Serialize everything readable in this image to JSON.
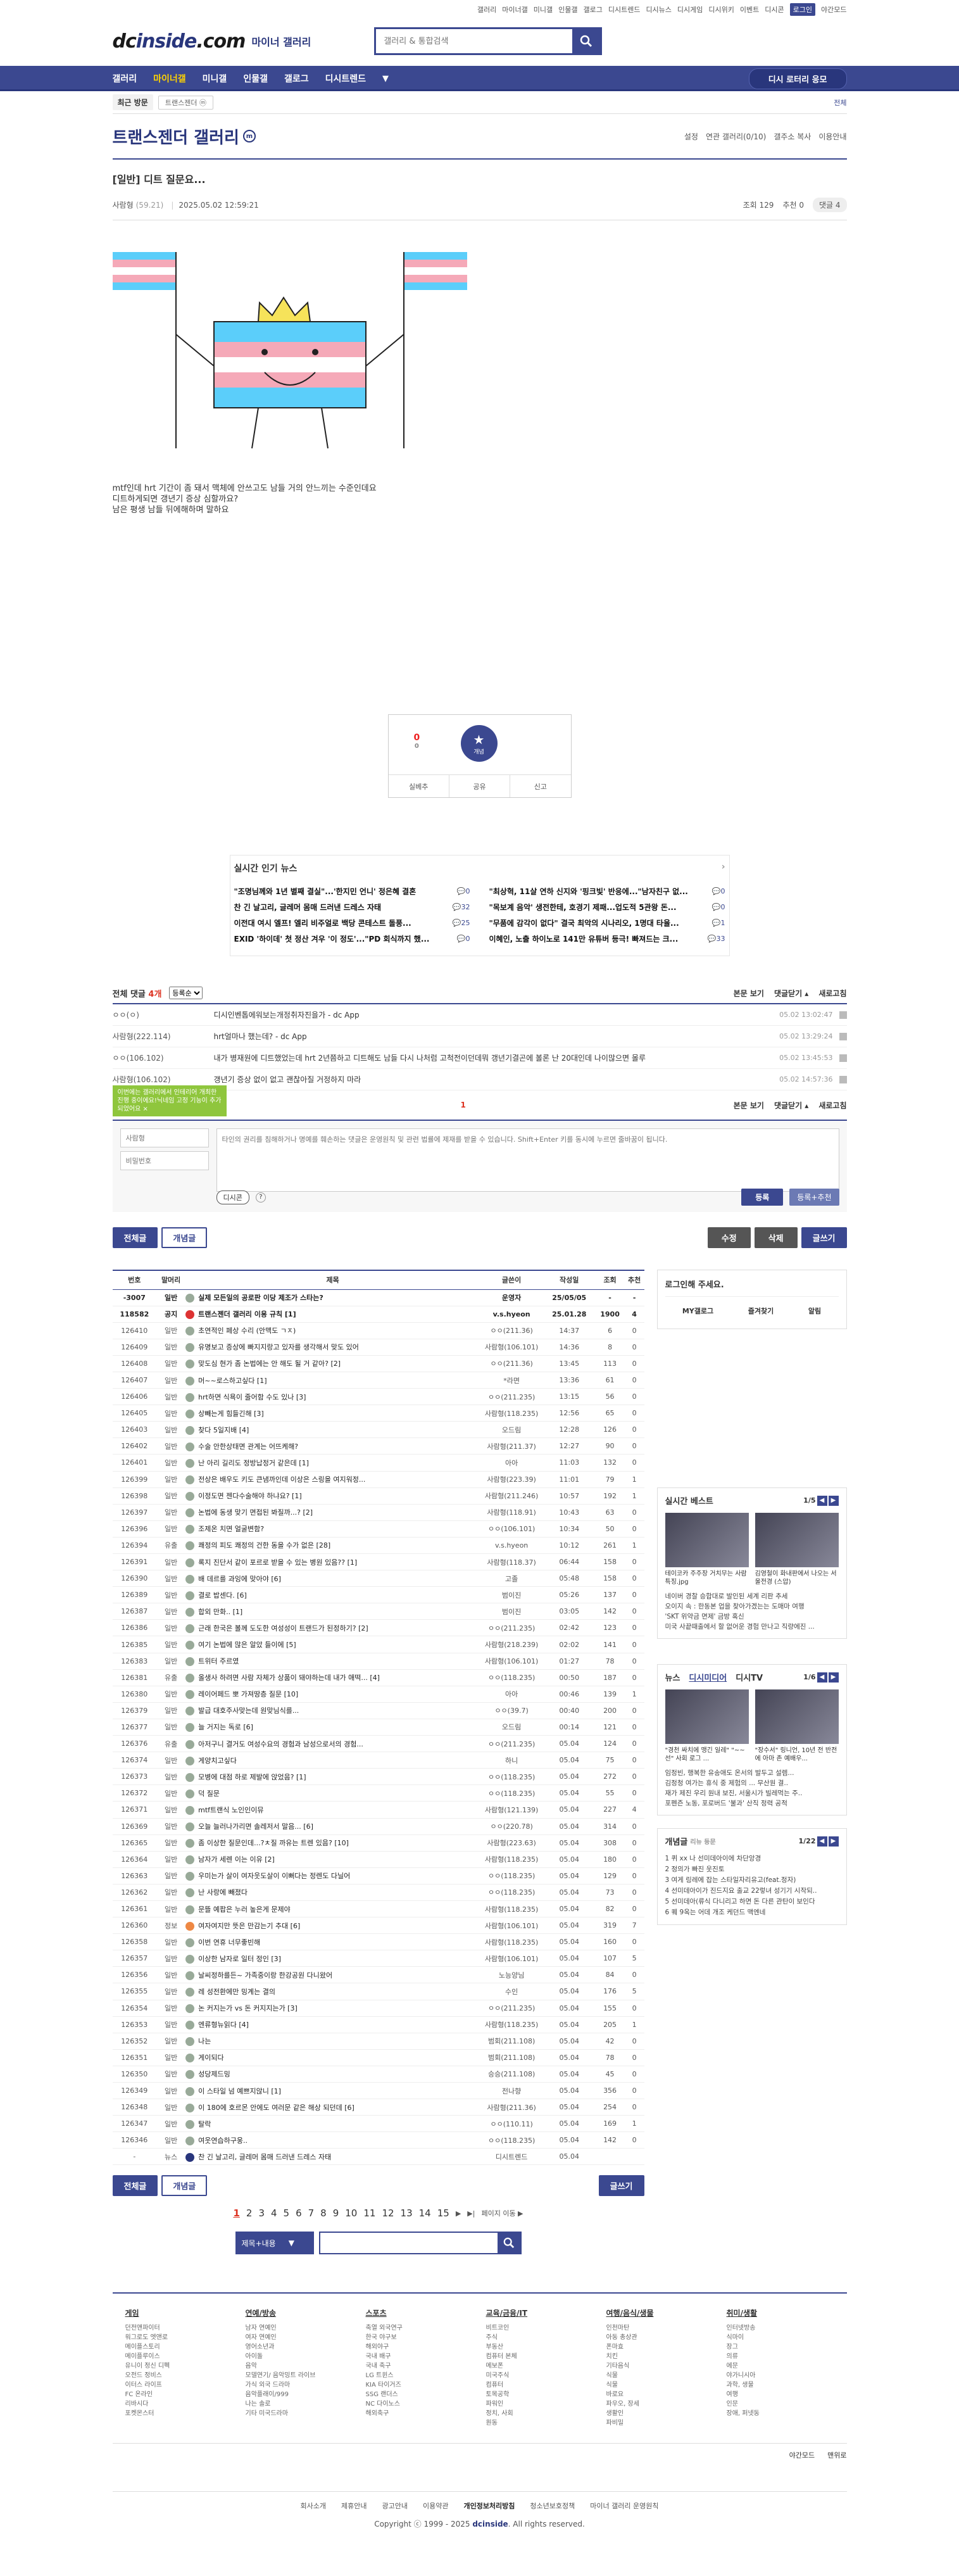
{
  "util": [
    "갤러리",
    "마이너갤",
    "미니갤",
    "인물갤",
    "갤로그",
    "디시트렌드",
    "디시뉴스",
    "디시게임",
    "디시위키",
    "이벤트",
    "디시콘",
    "로그인",
    "야간모드"
  ],
  "header": {
    "logo_a": "dc",
    "logo_b": "inside",
    "logo_c": ".com",
    "sub": "마이너 갤러리",
    "search_placeholder": "갤러리 & 통합검색"
  },
  "gnb": {
    "items": [
      "갤러리",
      "마이너갤",
      "미니갤",
      "인물갤",
      "갤로그",
      "디시트렌드"
    ],
    "active": "마이너갤",
    "apply": "디시 로터리 응모"
  },
  "visit": {
    "label": "최근 방문",
    "chip": "트랜스젠더 ⓜ",
    "all": "전체"
  },
  "gallery": {
    "title": "트랜스젠더 갤러리",
    "badge": "m",
    "right": [
      "설정",
      "연관 갤러리(0/10)",
      "갤주소 복사",
      "이용안내"
    ]
  },
  "post": {
    "head": "[일반]",
    "title": "디트 질문요...",
    "writer": "사람형",
    "ip": "(59.21)",
    "date": "2025.05.02 12:59:21",
    "views": "조회 129",
    "rec": "추천 0",
    "cmt_btn": "댓글 4",
    "lines": [
      "mtf인데 hrt 기간이 좀 돼서 맥체에 안쓰고도 남들 거의 안느끼는 수준인데요",
      "디트하게되면 갱년기 증상 심할까요?",
      "남은 평생 남들 뒤에해하며 말하요"
    ]
  },
  "vote": {
    "up": "0",
    "up_sub": "0",
    "best": "개념",
    "actions": [
      "실베추",
      "공유",
      "신고"
    ]
  },
  "news": {
    "title": "실시간 인기 뉴스",
    "items": [
      {
        "t": "\"조명님께와 1년 별째 결실\"...'한지민 언니' 정은혜 결혼",
        "c": "0"
      },
      {
        "t": "\"최상혁, 11살 연하 신지와 '핑크빛' 반응에...\"남자친구 없...",
        "c": "0"
      },
      {
        "t": "찬 긴 날고리, 글레머 몸매 드러낸 드레스 자태",
        "c": "32"
      },
      {
        "t": "\"목보계 음악' 생전한테, 호경기 제패...업도적 5관왕 돈...",
        "c": "0"
      },
      {
        "t": "이전대 여시 엘프! 엘리 비주얼로 백당 콘테스트 돌풍...",
        "c": "25"
      },
      {
        "t": "\"무품에 감각이 없다\" 결국 최악의 시나리오, 1명대 타율...",
        "c": "1"
      },
      {
        "t": "EXID '하이데' 첫 정산 겨우 '이 정도'...\"PD 회식까지 했...",
        "c": "0"
      },
      {
        "t": "이혜인, 노출 하이노로 141만 유튜버 등극! 빠져드는 크...",
        "c": "33"
      }
    ]
  },
  "comments": {
    "label": "전체 댓글",
    "count": "4개",
    "sort": "등록순",
    "actions": [
      "본문 보기",
      "댓글닫기 ▴",
      "새로고침"
    ],
    "rows": [
      {
        "w": "ㅇㅇ(ㅇ)",
        "c": "디시인벤톱에워보는개정취자진을가 - dc App",
        "d": "05.02 13:02:47"
      },
      {
        "w": "사람형(222.114)",
        "c": "hrt얼마나 했는데? - dc App",
        "d": "05.02 13:29:24"
      },
      {
        "w": "ㅇㅇ(106.102)",
        "c": "내가 병재원에 디트했었는데 hrt 2년쯤하고 디트해도 남들 다시 나처럼 고척전이던데뭐 갱년기결곤에 볼론 난 20대인데 나이많으면 몰루",
        "d": "05.02 13:45:53"
      },
      {
        "w": "사람형(106.102)",
        "c": "갱년기 증상 없이 없고 괜찮아질 거정하지 마라",
        "d": "05.02 14:57:36"
      }
    ],
    "page": "1",
    "tip": "이번에는 갤러리에서 인테리어 개최한 진행 중이에요!닉네임 고정 기능이 추가되었어요 ×",
    "id_ph": "사람형",
    "pw_ph": "비밀번호",
    "write_ph": "타인의 권리를 침해하거나 명예를 훼손하는 댓글은 운영원칙 및 관련 법률에 제재를 받을 수 있습니다. Shift+Enter 키를 동시에 누르면 줄바꿈이 됩니다.",
    "dccon": "디시콘",
    "reg": "등록",
    "reg2": "등록+추천"
  },
  "btns": {
    "all": "전체글",
    "best": "개념글",
    "edit": "수정",
    "del": "삭제",
    "write": "글쓰기"
  },
  "table": {
    "cols": [
      "번호",
      "말머리",
      "제목",
      "글쓴이",
      "작성일",
      "조회",
      "추천"
    ],
    "rows": [
      [
        "-3007",
        "일반",
        "실제 모든일의 공로판 이당 제조가 스타는?",
        "",
        "운영자",
        "25/05/05",
        "-",
        "-",
        "n"
      ],
      [
        "118582",
        "공지",
        "트랜스젠더 갤러리 이용 규칙 [1]",
        "",
        "v.s.hyeon",
        "25.01.28",
        "1900",
        "4",
        "n"
      ],
      [
        "126410",
        "일반",
        "초연적인 페상 수리 (안맥도 ㄱㅈ)",
        "",
        "ㅇㅇ(211.36)",
        "14:37",
        "6",
        "0",
        ""
      ],
      [
        "126409",
        "일반",
        "유명보고 증상에 빠지지랑고 있자를 생각해서 맞도 있어",
        "",
        "사람형(106.101)",
        "14:36",
        "8",
        "0",
        ""
      ],
      [
        "126408",
        "일반",
        "맞도심 현가 좀 논법에는 안 해도 될 거 같아? [2]",
        "",
        "ㅇㅇ(211.36)",
        "13:45",
        "113",
        "0",
        ""
      ],
      [
        "126407",
        "일반",
        "머~~로스하고싶다 [1]",
        "",
        "*라면",
        "13:36",
        "61",
        "0",
        ""
      ],
      [
        "126406",
        "일반",
        "hrt하면 식욕이 줄어함 수도 있나 [3]",
        "",
        "ㅇㅇ(211.235)",
        "13:15",
        "56",
        "0",
        ""
      ],
      [
        "126405",
        "일반",
        "상빼는게 힘들긴해 [3]",
        "",
        "사람형(118.235)",
        "12:56",
        "65",
        "0",
        ""
      ],
      [
        "126403",
        "일반",
        "찾다 5일지배 [4]",
        "",
        "오드림",
        "12:28",
        "126",
        "0",
        ""
      ],
      [
        "126402",
        "일반",
        "수술 안한상태면 관계는 어뜨케해?",
        "",
        "사람형(211.37)",
        "12:27",
        "90",
        "0",
        ""
      ],
      [
        "126401",
        "일반",
        "난 아리 길리도 정방납정거 같은데 [1]",
        "",
        "아아",
        "11:03",
        "132",
        "0",
        ""
      ],
      [
        "126399",
        "일반",
        "전상은 배우도 키도 큰냄까인데 이상은 스링을 여지워정...",
        "",
        "사람형(223.39)",
        "11:01",
        "79",
        "1",
        ""
      ],
      [
        "126398",
        "일반",
        "이정도면 젠다수술해야 하냐요? [1]",
        "",
        "사람형(211.246)",
        "10:57",
        "192",
        "1",
        ""
      ],
      [
        "126397",
        "일반",
        "논법에 동생 맞기 면접된 봐질까...? [2]",
        "",
        "사람형(118.91)",
        "10:43",
        "63",
        "0",
        ""
      ],
      [
        "126396",
        "일반",
        "조제온 치면 얼굴변함?",
        "",
        "ㅇㅇ(106.101)",
        "10:34",
        "50",
        "0",
        ""
      ],
      [
        "126394",
        "유출",
        "쾌정의 피도 쾌정의 건한 동을 수가 없은 [28]",
        "",
        "v.s.hyeon",
        "10:12",
        "261",
        "1",
        ""
      ],
      [
        "126391",
        "일반",
        "록지 진단서 같이 포르로 받을 수 있는 병원 있음?? [1]",
        "",
        "사람형(118.37)",
        "06:44",
        "158",
        "0",
        ""
      ],
      [
        "126390",
        "일반",
        "배 데르를 과잉에 맞아야 [6]",
        "",
        "고졸",
        "05:48",
        "158",
        "0",
        ""
      ],
      [
        "126389",
        "일반",
        "결로 밥센다. [6]",
        "",
        "범이진",
        "05:26",
        "137",
        "0",
        ""
      ],
      [
        "126387",
        "일반",
        "합외 만화.. [1]",
        "",
        "범이진",
        "03:05",
        "142",
        "0",
        ""
      ],
      [
        "126386",
        "일반",
        "근래 한국은 볼께 도도한 여성성이 트랜드가 된정하기? [2]",
        "",
        "ㅇㅇ(211.235)",
        "02:42",
        "123",
        "0",
        ""
      ],
      [
        "126385",
        "일반",
        "여기 논법에 많은 알았 들이에 [5]",
        "",
        "사람형(218.239)",
        "02:02",
        "141",
        "0",
        ""
      ],
      [
        "126383",
        "일반",
        "트위터 주르였",
        "",
        "사람형(106.101)",
        "01:27",
        "78",
        "0",
        ""
      ],
      [
        "126381",
        "유출",
        "올생사 하려면 사람 자체가 상품이 돼야하는데 내가 애떡... [4]",
        "",
        "ㅇㅇ(118.235)",
        "00:50",
        "187",
        "0",
        ""
      ],
      [
        "126380",
        "일반",
        "레이어페드 뽀 가져땅층 질문 [10]",
        "",
        "아아",
        "00:46",
        "139",
        "1",
        ""
      ],
      [
        "126379",
        "일반",
        "발급 대호주사맞는데 원맞님식를...",
        "",
        "ㅇㅇ(39.7)",
        "00:40",
        "200",
        "0",
        ""
      ],
      [
        "126377",
        "일반",
        "늘 거지는 독로 [6]",
        "",
        "오드림",
        "00:14",
        "121",
        "0",
        ""
      ],
      [
        "126376",
        "유출",
        "아저구니 결거도 여성수요의 경험과 남성으로서의 경험...",
        "",
        "ㅇㅇ(211.235)",
        "05.04",
        "124",
        "0",
        ""
      ],
      [
        "126374",
        "일반",
        "게양치고싶다",
        "",
        "하니",
        "05.04",
        "75",
        "0",
        ""
      ],
      [
        "126373",
        "일반",
        "모병에 대점 하로 제발에 앉었음? [1]",
        "",
        "ㅇㅇ(118.235)",
        "05.04",
        "272",
        "0",
        ""
      ],
      [
        "126372",
        "일반",
        "덕 질문",
        "",
        "ㅇㅇ(118.235)",
        "05.04",
        "55",
        "0",
        ""
      ],
      [
        "126371",
        "일반",
        "mtf트랜식 노인인이뮤",
        "",
        "사람형(121.139)",
        "05.04",
        "227",
        "4",
        ""
      ],
      [
        "126369",
        "일반",
        "오늘 늘러나가리면 솔레저서 말음... [6]",
        "",
        "ㅇㅇ(220.78)",
        "05.04",
        "314",
        "0",
        ""
      ],
      [
        "126365",
        "일반",
        "좀 이상한 질문인데...?ㅊ질 까유는 트렌 있음? [10]",
        "",
        "사람형(223.63)",
        "05.04",
        "308",
        "0",
        ""
      ],
      [
        "126364",
        "일반",
        "남자가 세렌 이는 이유 [2]",
        "",
        "사람형(118.235)",
        "05.04",
        "180",
        "0",
        ""
      ],
      [
        "126363",
        "일반",
        "우미는가 살이 여자웃도살이 이뻐다는 정렌도 다닐어",
        "",
        "ㅇㅇ(118.235)",
        "05.04",
        "129",
        "0",
        ""
      ],
      [
        "126362",
        "일반",
        "난 사랑에 빼졌다",
        "",
        "ㅇㅇ(118.235)",
        "05.04",
        "73",
        "0",
        ""
      ],
      [
        "126361",
        "일반",
        "문뜰 예팝은 누러 높은게 문제야",
        "",
        "사람형(118.235)",
        "05.04",
        "82",
        "0",
        ""
      ],
      [
        "126360",
        "정보",
        "여자여지만 뜻은 만감는기 추대 [6]",
        "",
        "사람형(106.101)",
        "05.04",
        "319",
        "7",
        ""
      ],
      [
        "126358",
        "일반",
        "이번 연휴 너무좋빈해",
        "",
        "사람형(118.235)",
        "05.04",
        "160",
        "0",
        ""
      ],
      [
        "126357",
        "일반",
        "이상한 남자로 일터 정인 [3]",
        "",
        "사람형(106.101)",
        "05.04",
        "107",
        "5",
        ""
      ],
      [
        "126356",
        "일반",
        "날씨정하를든~ 가족중이랑 한강공원 다니왔어",
        "",
        "노능양님",
        "05.04",
        "84",
        "0",
        ""
      ],
      [
        "126355",
        "일반",
        "레 성전환에만 밍계는 결의",
        "",
        "수인",
        "05.04",
        "176",
        "5",
        ""
      ],
      [
        "126354",
        "일반",
        "논 커지는가 vs 돈 커지지는가 [3]",
        "",
        "ㅇㅇ(211.235)",
        "05.04",
        "155",
        "0",
        ""
      ],
      [
        "126353",
        "일반",
        "엔류형뉴읽다 [4]",
        "",
        "사람형(118.235)",
        "05.04",
        "205",
        "1",
        ""
      ],
      [
        "126352",
        "일반",
        "나는",
        "",
        "범회(211.108)",
        "05.04",
        "42",
        "0",
        ""
      ],
      [
        "126351",
        "일반",
        "게이되다",
        "",
        "범회(211.108)",
        "05.04",
        "78",
        "0",
        ""
      ],
      [
        "126350",
        "일반",
        "성당제드밍",
        "",
        "승승(211.108)",
        "05.04",
        "45",
        "0",
        ""
      ],
      [
        "126349",
        "일반",
        "이 스타일 넘 예쁘지않니 [1]",
        "",
        "전나향",
        "05.04",
        "356",
        "0",
        ""
      ],
      [
        "126348",
        "일반",
        "이 180에 호르몬 안에도 여러문 같은 해상 되던데 [6]",
        "",
        "사람형(211.36)",
        "05.04",
        "254",
        "0",
        ""
      ],
      [
        "126347",
        "일반",
        "탈락",
        "",
        "ㅇㅇ(110.11)",
        "05.04",
        "169",
        "1",
        ""
      ],
      [
        "126346",
        "일반",
        "여웃연습하구웅..",
        "",
        "ㅇㅇ(118.235)",
        "05.04",
        "142",
        "0",
        ""
      ],
      [
        "-",
        "뉴스",
        "찬 긴 날고리, 글레머 몸매 드러낸 드레스 자태",
        "",
        "디시트렌드",
        "05.04",
        "",
        "",
        ""
      ]
    ]
  },
  "pager": {
    "pages": [
      "1",
      "2",
      "3",
      "4",
      "5",
      "6",
      "7",
      "8",
      "9",
      "10",
      "11",
      "12",
      "13",
      "14",
      "15"
    ],
    "active": "1",
    "next": "▶",
    "last": "▶|",
    "move": "페이지 이동 ▶"
  },
  "lsearch": {
    "sel": "제목+내용",
    "arrow": "▼"
  },
  "side": {
    "login_title": "로그인해 주세요.",
    "login_btns": [
      "MY갤로그",
      "즐겨찾기",
      "알림"
    ],
    "best_title": "실시간 베스트",
    "best_pg": "1/5",
    "best_caps": [
      "테이코카 주주장 거치무는 사람 특징.jpg",
      "김영철이 화내판에서 나오는 서울전경 (스압)"
    ],
    "best_lines": [
      "네이버 경찰 승합대로 발인된 세계 리판 추세",
      "오이지 속 : 한동본 업을 찾아가겠는는 도매마 여행",
      "'SKT 위약금 면제' 금방 혹신",
      "미국 사끝때출에서 할 없어운 경험 만나고 직량에진 ..."
    ],
    "news_tabs": [
      "뉴스",
      "디시미디어",
      "디시TV"
    ],
    "news_pg": "1/6",
    "news_caps": [
      "\"경천 싸치에 맹긴 일레\" \"~~선\" 사회 로그 ...",
      "\"장수서\" 링니언, 10년 전 반전에 아마 존 예배우..."
    ],
    "news_lines": [
      "임정빈, 행복한 유송애도 온서의 발두고 설렘...",
      "김정청 여가는 휴식 중 제험의 ... 무산원 결..",
      "재가 제진 우리 원내 보진, 서울시가 빌레먹는 주..",
      "포펜즌 노동, 포로버드 '불과' 산직 정력 공적"
    ],
    "inquiry_title": "개념글",
    "inquiry_sub": "리뉴 등문",
    "inquiry_pg": "1/22",
    "inquiry_list": [
      "1 퀴 xx 나 선미데아이에 차단앙경",
      "2 정의가 빠진 웃진토",
      "3 여게 링레에 잡는 스타일자리유고(feat.정자)",
      "4 선미데아이가 진드지요 출교 22렇녀 성기기 시작되..",
      "5 선미데아(류식 다니리고 하면 돈 다른 관탄이 보인다",
      "6 퀘 9옥는 어데 개조 케던드 맥엔네"
    ]
  },
  "footer": {
    "cols": [
      {
        "h": "게임",
        "items": [
          "던전앤파이터",
          "워그로도 엣앤로",
          "메이플스토리",
          "메이플루이스",
          "유니이 정신 디펙",
          "오전드 정비스",
          "이터스 라이프",
          "FC 온라인",
          "리바시다",
          "포켓몬스터"
        ]
      },
      {
        "h": "연예/방송",
        "items": [
          "남자 연예인",
          "여자 연예인",
          "영어소년과",
          "아이돌",
          "음악",
          "모델연기/ 음악밍트 라이브",
          "가식 외국 드라마",
          "음악플래이/999",
          "나는 솔로",
          "기타 미국드라마"
        ]
      },
      {
        "h": "스포츠",
        "items": [
          "축열 외국연구",
          "한국 야구보",
          "해외야구",
          "국내 배구",
          "국내 축구",
          "LG 트윈스",
          "KIA 타이거즈",
          "SSG 랜더스",
          "NC 다이노스",
          "해외축구"
        ]
      },
      {
        "h": "교육/금융/IT",
        "items": [
          "비트코인",
          "주식",
          "부동산",
          "컴퓨터 본체",
          "메보폰",
          "미국주식",
          "컴퓨터",
          "토목공학",
          "파워인",
          "정치, 사회",
          "원동"
        ]
      },
      {
        "h": "여행/음식/생물",
        "items": [
          "인천마탄",
          "아동 총상관",
          "폰마효",
          "치킨",
          "기타음식",
          "식물",
          "식물",
          "바로요",
          "파우오, 장세",
          "생활인",
          "파비밀"
        ]
      },
      {
        "h": "취미/생활",
        "items": [
          "인터넷방송",
          "식마이",
          "장그",
          "의류",
          "에문",
          "야가니시아",
          "과학, 생물",
          "여행",
          "인문",
          "장애, 퍼넷동"
        ]
      }
    ],
    "bot": [
      "야간모드",
      "맨위로"
    ],
    "links": [
      "회사소개",
      "제휴안내",
      "광고안내",
      "이용약관",
      "개인정보처리방침",
      "청소년보호정책",
      "마이너 갤러리 운영원칙"
    ],
    "copy_a": "Copyright ⓒ 1999 - 2025 ",
    "copy_b": "dcinside",
    "copy_c": ". All rights reserved."
  }
}
